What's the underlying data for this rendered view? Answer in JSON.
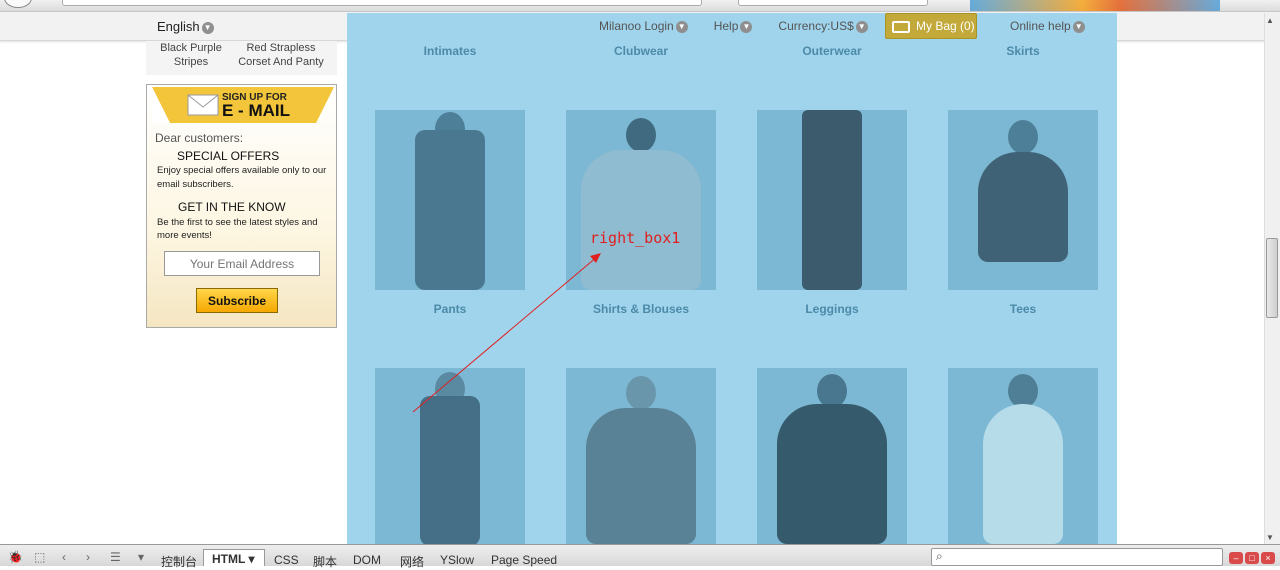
{
  "site": {
    "language": "English",
    "nav": [
      "Milanoo Login",
      "Help",
      "Currency:US$"
    ],
    "bag": "My Bag (0)",
    "online_help": "Online help"
  },
  "promo": {
    "item1": [
      "Black Purple",
      "Stripes"
    ],
    "item2": [
      "Red Strapless",
      "Corset And Panty"
    ]
  },
  "signup": {
    "banner_small": "SIGN UP FOR",
    "banner_big": "E - MAIL",
    "dear": "Dear customers:",
    "special_title": "SPECIAL OFFERS",
    "special_desc": "Enjoy special offers available only to our email subscribers.",
    "know_title": "GET IN THE KNOW",
    "know_desc": "Be the first to see the latest styles and more events!",
    "email_placeholder": "Your Email Address",
    "subscribe": "Subscribe"
  },
  "categories": {
    "row1": [
      "Intimates",
      "Clubwear",
      "Outerwear",
      "Skirts"
    ],
    "row2": [
      "Pants",
      "Shirts & Blouses",
      "Leggings",
      "Tees"
    ]
  },
  "annotation": "right_box1",
  "devtools": {
    "tabs": [
      "控制台",
      "HTML",
      "CSS",
      "脚本",
      "DOM",
      "网络",
      "YSlow",
      "Page Speed"
    ]
  },
  "colors": {
    "overlay": "#9fd4ec",
    "annotation": "#e02020",
    "subscribe": "#f5a800"
  }
}
